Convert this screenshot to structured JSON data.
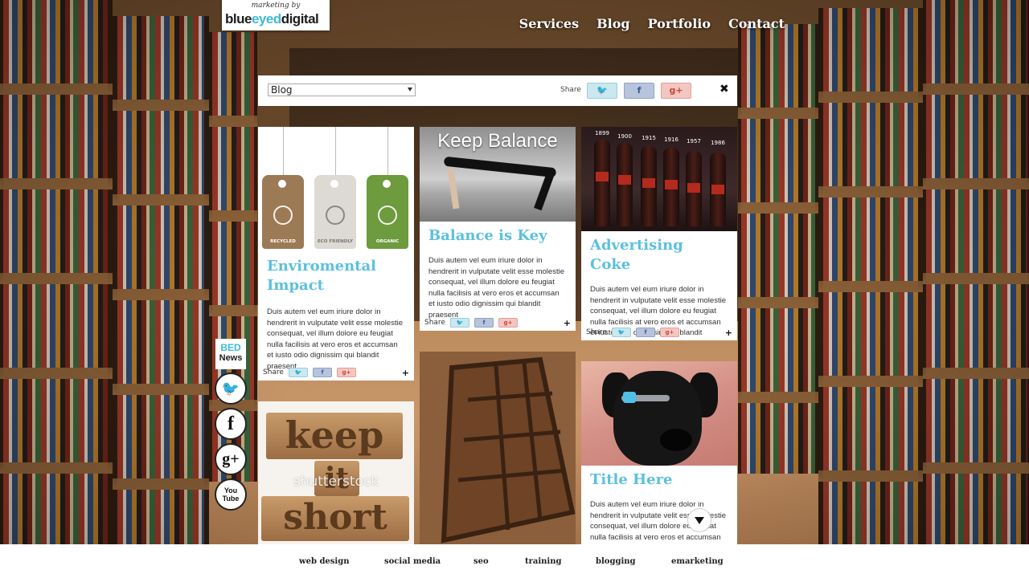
{
  "brand": {
    "tagline": "marketing by",
    "name_part1": "blue",
    "name_part2": "eyed",
    "name_part3": "digital",
    "accent_color": "#5bc0de"
  },
  "nav": {
    "items": [
      "Services",
      "Blog",
      "Portfolio",
      "Contact"
    ]
  },
  "filter": {
    "selected": "Blog",
    "share_label": "Share",
    "twitter_icon": "twitter-icon",
    "facebook_icon": "facebook-icon",
    "gplus_icon": "google-plus-icon",
    "twitter_glyph": "🐦",
    "facebook_glyph": "f",
    "gplus_glyph": "g+",
    "close_glyph": "✖"
  },
  "rail": {
    "bed_line1": "BED",
    "bed_line2": "News",
    "twitter_glyph": "🐦",
    "facebook_glyph": "f",
    "gplus_glyph": "g+",
    "youtube_line1": "You",
    "youtube_line2": "Tube"
  },
  "cards": {
    "env": {
      "title": "Enviromental Impact",
      "tags": [
        "RECYCLED",
        "ECO FRIENDLY",
        "ORGANIC"
      ],
      "body": "Duis autem vel eum iriure dolor in hendrerit in vulputate velit esse molestie consequat, vel illum dolore eu feugiat nulla facilisis at vero eros et accumsan et iusto odio dignissim qui blandit praesent",
      "share_label": "Share"
    },
    "balance": {
      "image_text": "Keep Balance",
      "title": "Balance is Key",
      "body": "Duis autem vel eum iriure dolor in hendrerit in vulputate velit esse molestie consequat, vel illum dolore eu feugiat nulla facilisis at vero eros et accumsan et iusto odio dignissim qui blandit praesent",
      "share_label": "Share"
    },
    "coke": {
      "years": [
        "1899",
        "1900",
        "1915",
        "1916",
        "1957",
        "1986"
      ],
      "title": "Advertising Coke",
      "body": "Duis autem vel eum iriure dolor in hendrerit in vulputate velit esse molestie consequat, vel illum dolore eu feugiat nulla facilisis at vero eros et accumsan et iusto odio dignissim qui blandit praesent",
      "share_label": "Share"
    },
    "keep": {
      "words": [
        "keep",
        "it",
        "short"
      ],
      "watermark": "shutterstock"
    },
    "dog": {
      "title": "Title Here",
      "body": "Duis autem vel eum iriure dolor in hendrerit in vulputate velit esse molestie consequat, vel illum dolore eu feugiat nulla facilisis at vero eros et accumsan et iusto odio dignissim qui blandit praesent"
    },
    "plus_glyph": "+"
  },
  "footer": {
    "links": [
      "web design",
      "social media",
      "seo",
      "training",
      "blogging",
      "emarketing"
    ]
  }
}
